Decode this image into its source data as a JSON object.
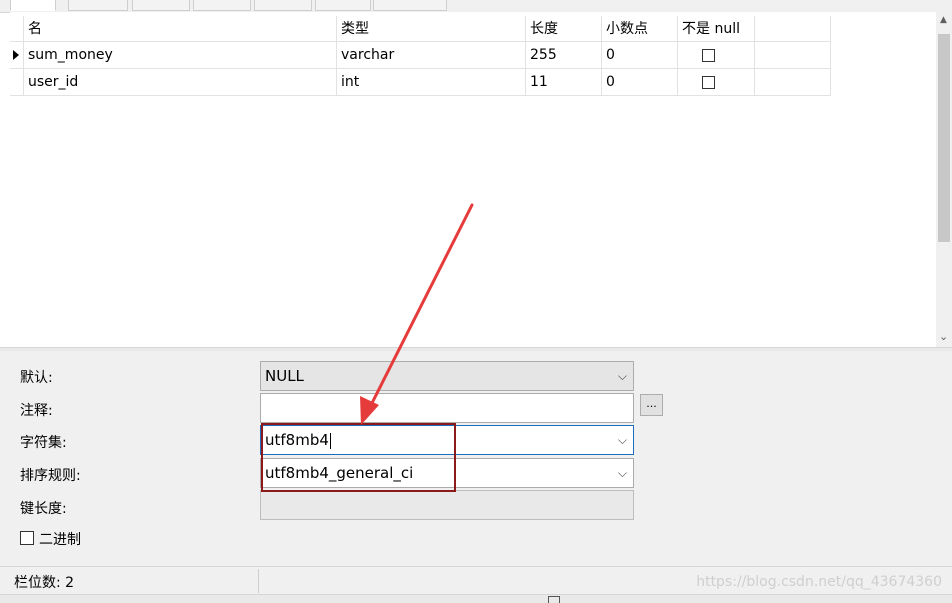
{
  "grid": {
    "columns": [
      "名",
      "类型",
      "长度",
      "小数点",
      "不是 null"
    ],
    "rows": [
      {
        "name": "sum_money",
        "type": "varchar",
        "length": "255",
        "decimal": "0"
      },
      {
        "name": "user_id",
        "type": "int",
        "length": "11",
        "decimal": "0"
      }
    ]
  },
  "props": {
    "default_label": "默认:",
    "default_value": "NULL",
    "comment_label": "注释:",
    "comment_value": "",
    "ellipsis": "...",
    "charset_label": "字符集:",
    "charset_value": "utf8mb4",
    "collation_label": "排序规则:",
    "collation_value": "utf8mb4_general_ci",
    "keylen_label": "键长度:",
    "binary_label": "二进制"
  },
  "status": {
    "field_count": "栏位数: 2",
    "watermark": "https://blog.csdn.net/qq_43674360"
  },
  "colors": {
    "annotation": "#8b1a1a",
    "arrow": "#e53b3b"
  },
  "icons": {
    "row_pointer": "triangle-right",
    "dropdown": "chevron-down",
    "checkbox": "square"
  }
}
